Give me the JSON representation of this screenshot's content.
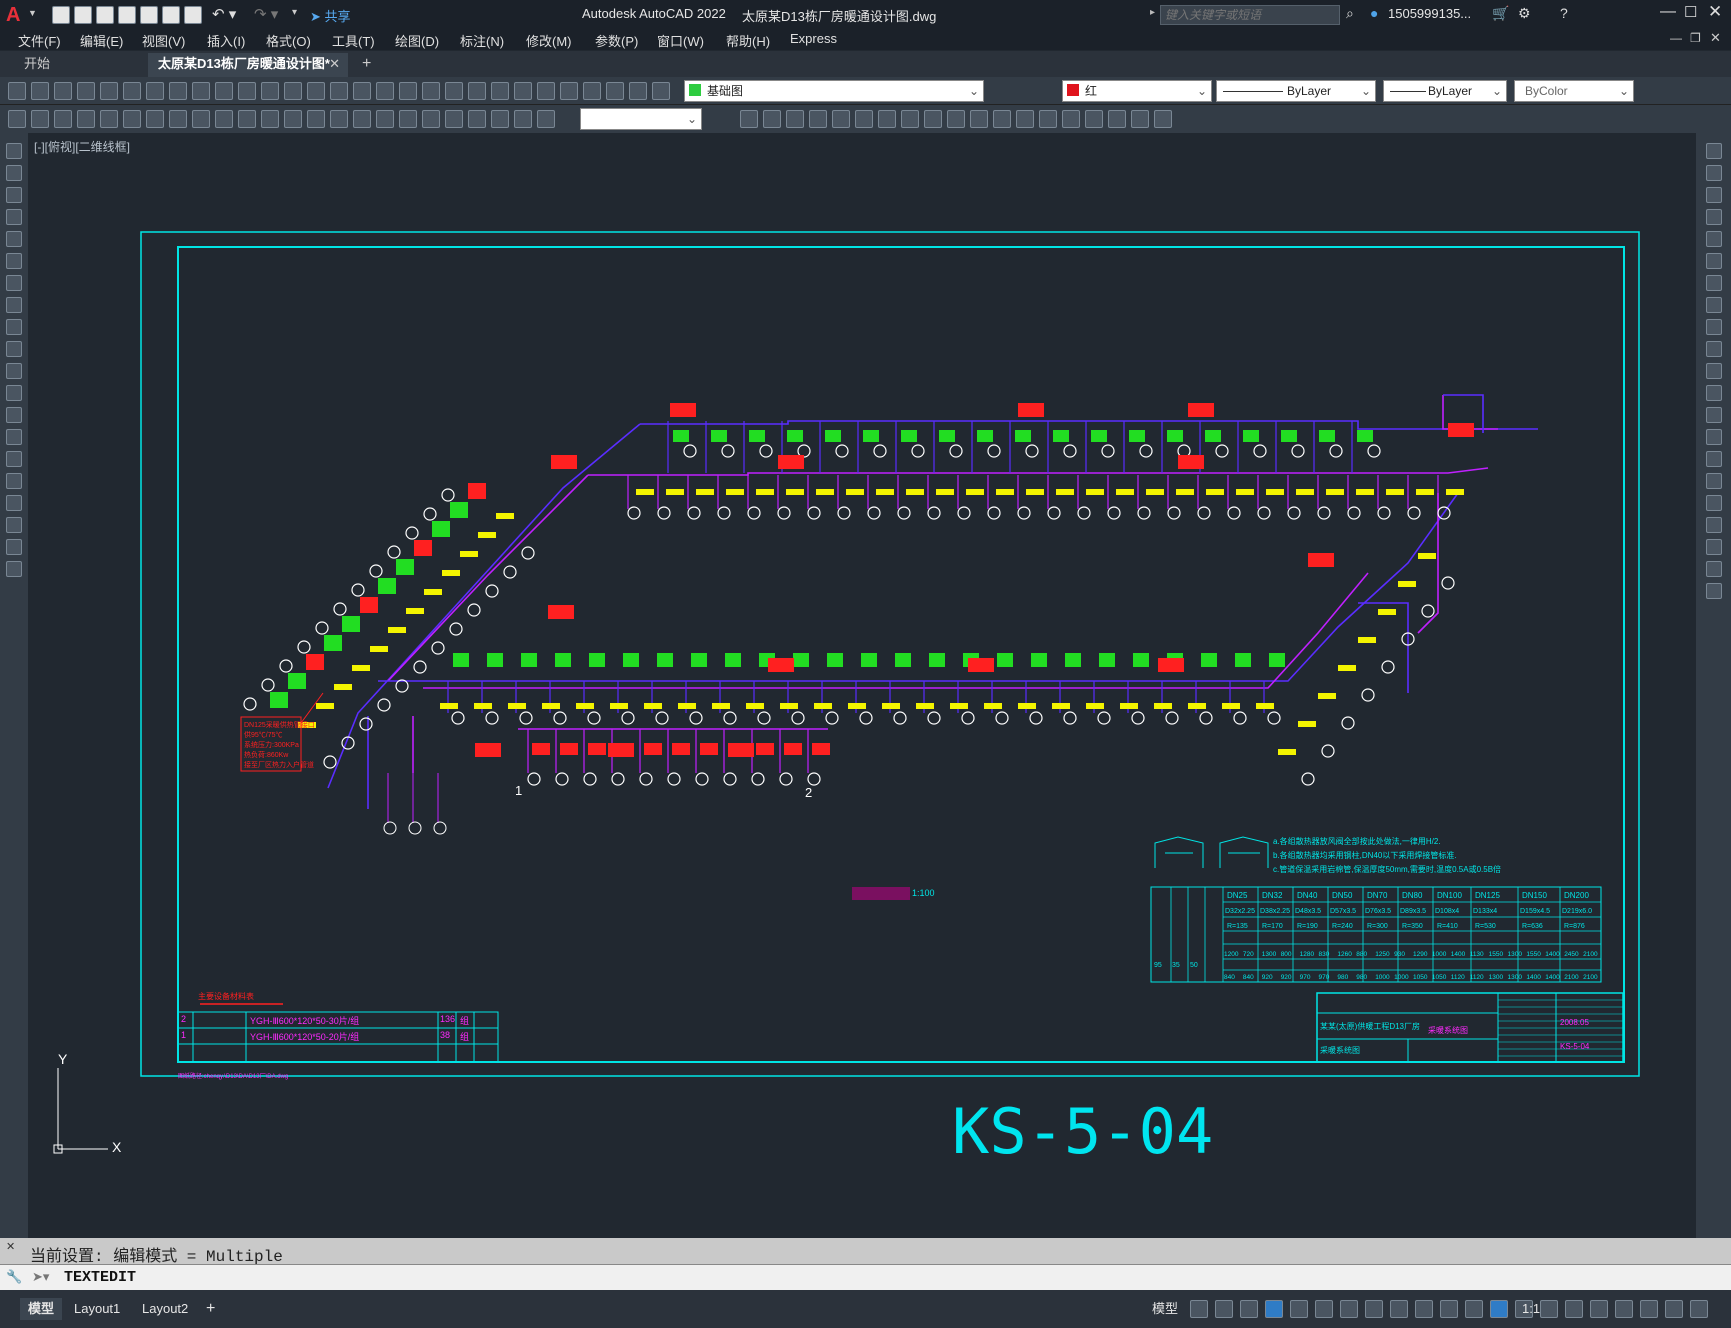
{
  "window": {
    "app_title": "Autodesk AutoCAD 2022",
    "file_title": "太原某D13栋厂房暖通设计图.dwg",
    "search_placeholder": "键入关键字或短语",
    "user": "1505999135...",
    "share_label": "共享"
  },
  "menu": {
    "items": [
      "文件(F)",
      "编辑(E)",
      "视图(V)",
      "插入(I)",
      "格式(O)",
      "工具(T)",
      "绘图(D)",
      "标注(N)",
      "修改(M)",
      "参数(P)",
      "窗口(W)",
      "帮助(H)",
      "Express"
    ]
  },
  "tabs": {
    "start": "开始",
    "doc": "太原某D13栋厂房暖通设计图*"
  },
  "toolbar": {
    "layer": "基础图",
    "color": "红",
    "linetype": "ByLayer",
    "lineweight": "ByLayer",
    "plotstyle": "ByColor"
  },
  "viewport": {
    "label": "[-][俯视][二维线框]"
  },
  "drawing": {
    "sheet_no": "KS-5-04",
    "scale": "1:100",
    "date": "2008.05",
    "equipment_title": "主要设备材料表",
    "equipment_rows": [
      {
        "no": "2",
        "model": "YGH-Ⅲ600*120*50-30片/组",
        "qty": "136",
        "unit": "组"
      },
      {
        "no": "1",
        "model": "YGH-Ⅲ600*120*50-20片/组",
        "qty": "38",
        "unit": "组"
      }
    ],
    "notes": [
      "a.各组散热器放风阀全部按此处做法,一律用H/2.",
      "b.各组散热器均采用钢柱,DN40以下采用焊接管标准.",
      "c.管道保温采用岩棉管,保温厚度50mm,需要时,温度0.5A或0.5B倍"
    ],
    "pipe_sizes": [
      "DN25",
      "DN32",
      "DN40",
      "DN50",
      "DN70",
      "DN80",
      "DN100",
      "DN125",
      "DN150",
      "DN200"
    ],
    "pipe_specs": [
      "D32x2.25",
      "D38x2.25",
      "D48x3.5",
      "D57x3.5",
      "D76x3.5",
      "D89x3.5",
      "D108x4",
      "D133x4",
      "D159x4.5",
      "D219x6.0"
    ],
    "radius": [
      "R=135",
      "R=170",
      "R=190",
      "R=240",
      "R=300",
      "R=350",
      "R=410",
      "R=530",
      "R=636",
      "R=876"
    ],
    "row1": [
      "1200",
      "720",
      "1300",
      "800",
      "1280",
      "830",
      "1260",
      "880",
      "1250",
      "930",
      "1290",
      "1000",
      "1400",
      "1130",
      "1550",
      "1300",
      "1550",
      "1400",
      "2450",
      "2100"
    ],
    "row2": [
      "840",
      "840",
      "920",
      "920",
      "970",
      "970",
      "980",
      "980",
      "1000",
      "1000",
      "1050",
      "1050",
      "1120",
      "1120",
      "1300",
      "1300",
      "1400",
      "1400",
      "2100",
      "2100"
    ],
    "left_params": [
      "95",
      "35",
      "50"
    ],
    "left_note_lines": [
      "DN125采暖供热管接口",
      "供95℃/75℃",
      "系统压力:300KPa",
      "热负荷:860Kw",
      "接至厂区热力入户管道"
    ],
    "path_note": "图纸路径:chenqy.\\D13\\DA\\D13厂\\DA.dwg",
    "title_block_project": "某某(太原)供暖工程D13厂房",
    "title_block_name": "采暖系统图",
    "title_block_stage": "采暖系统图",
    "node_1": "1",
    "node_2": "2",
    "ucs_y": "Y",
    "ucs_x": "X"
  },
  "command": {
    "history": "当前设置: 编辑模式 = Multiple",
    "current": "TEXTEDIT"
  },
  "status": {
    "model_tab": "模型",
    "layout1": "Layout1",
    "layout2": "Layout2",
    "model_btn": "模型",
    "scale": "1:1"
  }
}
